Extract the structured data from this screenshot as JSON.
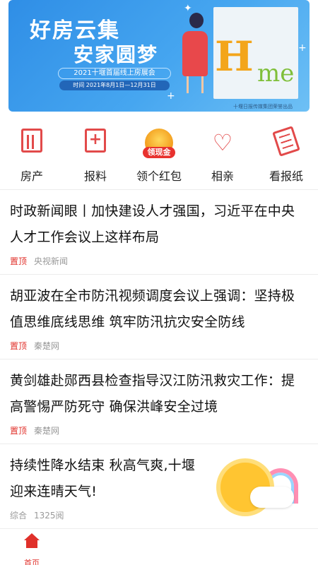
{
  "banner": {
    "title_line1": "好房云集",
    "title_line2": "安家圆梦",
    "event_name": "2021十堰首届线上房展会",
    "event_date": "时间 2021年8月1日—12月31日",
    "organizer": "十堰日报传媒集团荣誉出品",
    "art_text_h": "H",
    "art_text_me": "me"
  },
  "nav": [
    {
      "label": "房产",
      "icon": "building-icon"
    },
    {
      "label": "报料",
      "icon": "bookmark-plus-icon"
    },
    {
      "label": "领个红包",
      "icon": "red-packet-icon",
      "badge": "领现金"
    },
    {
      "label": "相亲",
      "icon": "hearts-icon"
    },
    {
      "label": "看报纸",
      "icon": "newspaper-icon"
    }
  ],
  "news": [
    {
      "title": "时政新闻眼丨加快建设人才强国，习近平在中央人才工作会议上这样布局",
      "tag": "置顶",
      "source": "央视新闻"
    },
    {
      "title": "胡亚波在全市防汛视频调度会议上强调：坚持极值思维底线思维  筑牢防汛抗灾安全防线",
      "tag": "置顶",
      "source": "秦楚网"
    },
    {
      "title": "黄剑雄赴郧西县检查指导汉江防汛救灾工作：提高警惕严防死守 确保洪峰安全过境",
      "tag": "置顶",
      "source": "秦楚网"
    },
    {
      "title": "持续性降水结束 秋高气爽,十堰迎来连晴天气!",
      "category": "综合",
      "views": "1325阅"
    }
  ],
  "tabbar": {
    "home_label": "首页"
  },
  "colors": {
    "accent": "#e0302a",
    "banner": "#3a9be9"
  }
}
